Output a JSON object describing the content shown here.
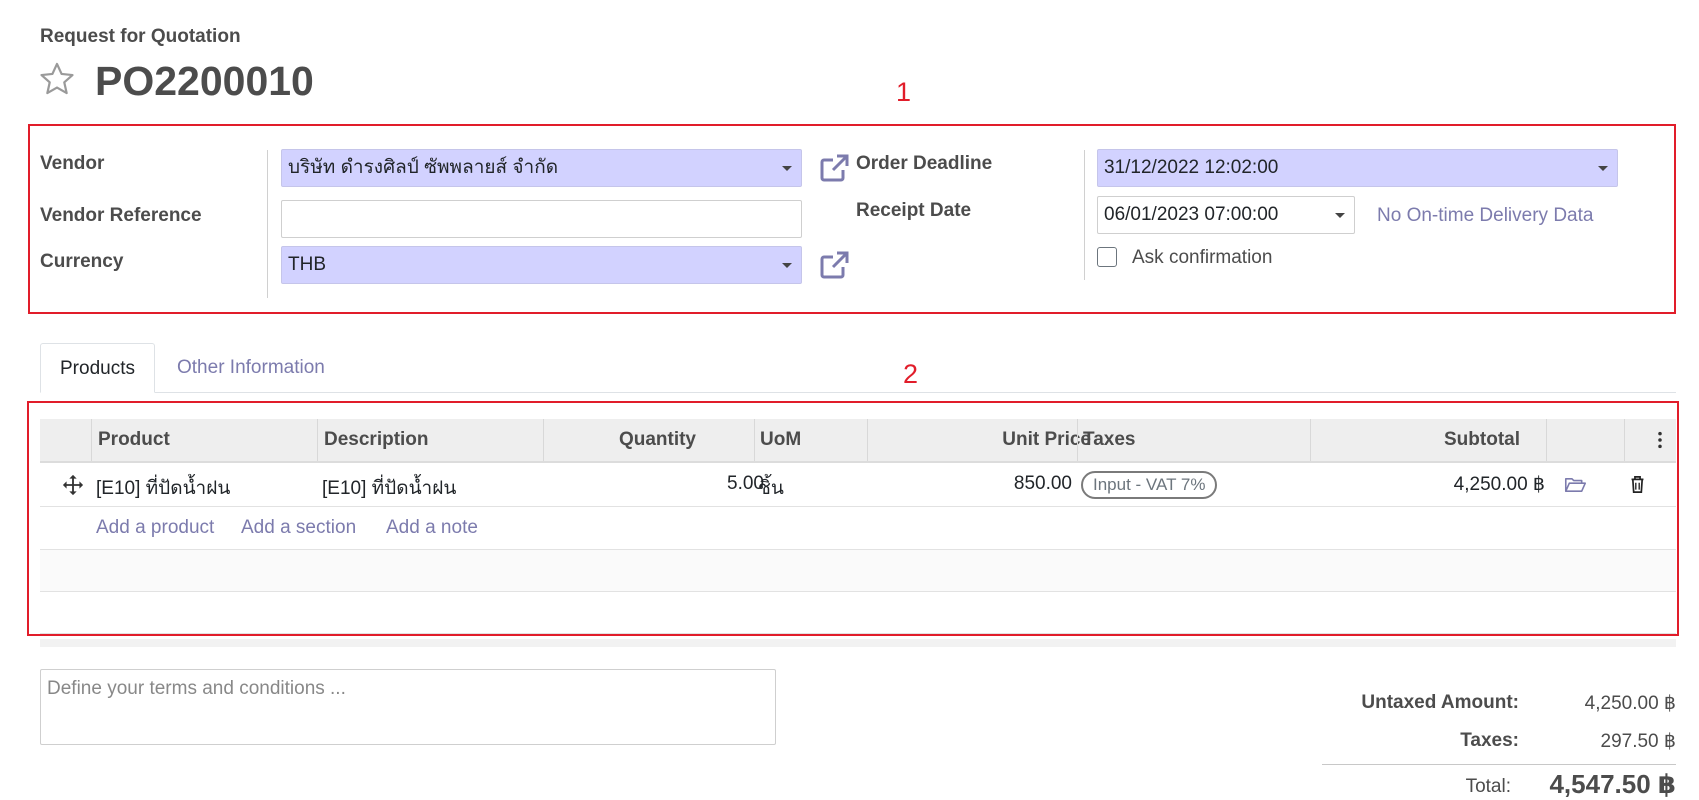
{
  "page": {
    "subtitle": "Request for Quotation",
    "record_name": "PO2200010"
  },
  "annotations": {
    "box1": "1",
    "box2": "2"
  },
  "form": {
    "vendor_label": "Vendor",
    "vendor_value": "บริษัท ดำรงศิลป์ ซัพพลายส์ จำกัด",
    "vendor_reference_label": "Vendor Reference",
    "vendor_reference_value": "",
    "currency_label": "Currency",
    "currency_value": "THB",
    "order_deadline_label": "Order Deadline",
    "order_deadline_value": "31/12/2022 12:02:00",
    "receipt_date_label": "Receipt Date",
    "receipt_date_value": "06/01/2023 07:00:00",
    "on_time_link": "No On-time Delivery Data",
    "ask_confirmation_label": "Ask confirmation",
    "ask_confirmation_checked": false
  },
  "tabs": [
    {
      "label": "Products",
      "active": true
    },
    {
      "label": "Other Information",
      "active": false
    }
  ],
  "table": {
    "columns": [
      "Product",
      "Description",
      "Quantity",
      "UoM",
      "Unit Price",
      "Taxes",
      "Subtotal"
    ],
    "rows": [
      {
        "product": "[E10] ที่ปัดน้ำฝน",
        "description": "[E10] ที่ปัดน้ำฝน",
        "quantity": "5.00",
        "uom": "ชิ้น",
        "unit_price": "850.00",
        "taxes": "Input - VAT 7%",
        "subtotal": "4,250.00 ฿"
      }
    ],
    "add_product": "Add a product",
    "add_section": "Add a section",
    "add_note": "Add a note"
  },
  "terms_placeholder": "Define your terms and conditions ...",
  "totals": {
    "untaxed_label": "Untaxed Amount:",
    "untaxed_value": "4,250.00 ฿",
    "taxes_label": "Taxes:",
    "taxes_value": "297.50 ฿",
    "total_label": "Total:",
    "total_value": "4,547.50 ฿"
  },
  "icons": {
    "favorite": "star-outline-icon",
    "external": "external-link-icon",
    "drag": "move-arrows-icon",
    "open": "folder-open-icon",
    "delete": "trash-icon",
    "options": "vertical-dots-icon"
  },
  "colors": {
    "required_field": "#d2d2ff",
    "link": "#7c7bad",
    "annotation": "#e11d2a"
  }
}
